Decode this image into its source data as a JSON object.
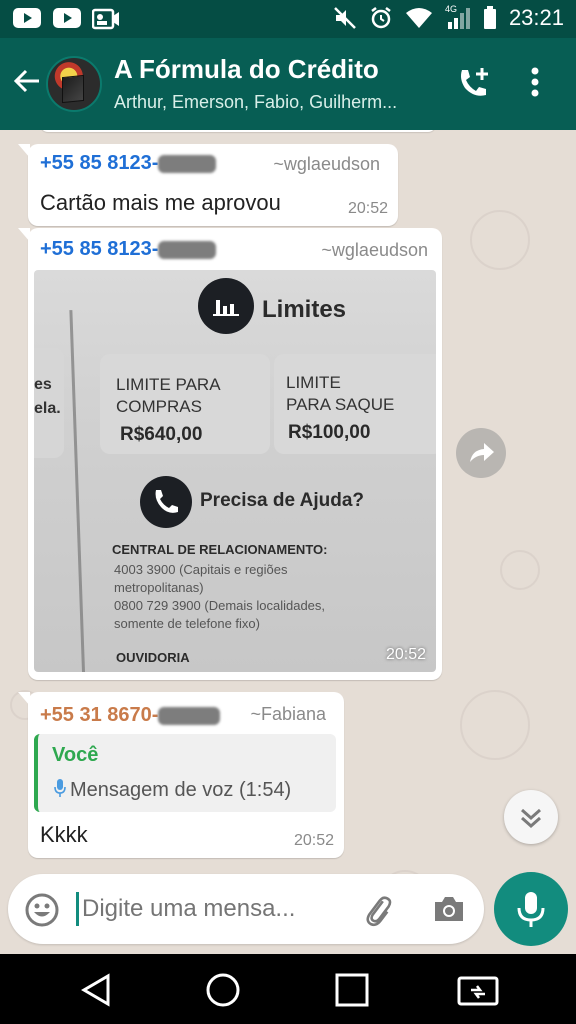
{
  "status_bar": {
    "time": "23:21",
    "network": "4G",
    "icons": [
      "youtube-icon",
      "youtube-icon",
      "videocam-icon",
      "mute-icon",
      "alarm-icon",
      "wifi-icon",
      "signal-icon",
      "battery-icon"
    ]
  },
  "header": {
    "title": "A Fórmula do Crédito",
    "subtitle": "Arthur, Emerson, Fabio, Guilherm..."
  },
  "messages": [
    {
      "sender": "+55 85 8123-",
      "alias": "~wglaeudson",
      "text": "Cartão mais me aprovou",
      "time": "20:52"
    },
    {
      "sender": "+55 85 8123-",
      "alias": "~wglaeudson",
      "time": "20:52",
      "image": {
        "heading": "Limites",
        "side_text": [
          "es",
          "ela."
        ],
        "card1_label": "LIMITE PARA\nCOMPRAS",
        "card1_value": "R$640,00",
        "card2_label": "LIMITE\nPARA SAQUE",
        "card2_value": "R$100,00",
        "help": "Precisa de Ajuda?",
        "central": "CENTRAL DE RELACIONAMENTO:",
        "lines": [
          "4003 3900 (Capitais e regiões",
          "metropolitanas)",
          "0800 729 3900 (Demais localidades,",
          "somente de telefone fixo)"
        ],
        "ouvidoria": "OUVIDORIA"
      }
    },
    {
      "sender": "+55 31 8670-",
      "alias": "~Fabiana",
      "quote_name": "Você",
      "quote_text": "Mensagem de voz (1:54)",
      "text": "Kkkk",
      "time": "20:52"
    }
  ],
  "input": {
    "placeholder": "Digite uma mensa..."
  },
  "colors": {
    "header": "#075e54",
    "status": "#054d44",
    "accent": "#128c7e",
    "sender_blue": "#1f6fd6",
    "sender_orange": "#c97b4a",
    "quote_green": "#2ea84f"
  }
}
